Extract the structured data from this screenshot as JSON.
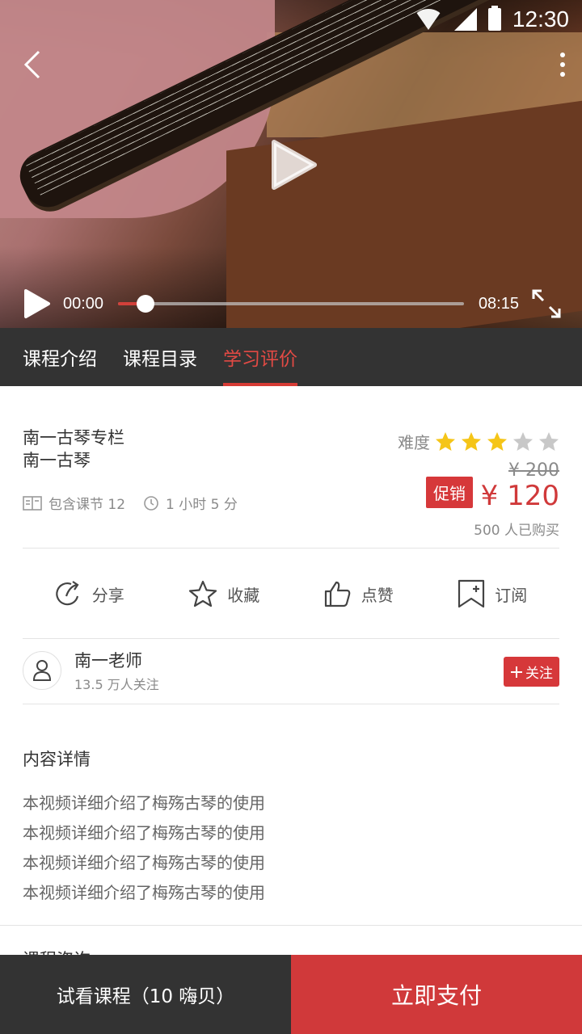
{
  "status_bar": {
    "time": "12:30"
  },
  "video": {
    "current_time": "00:00",
    "duration": "08:15",
    "progress": 0.08
  },
  "tabs": [
    {
      "label": "课程介绍",
      "active": false
    },
    {
      "label": "课程目录",
      "active": false
    },
    {
      "label": "学习评价",
      "active": true
    }
  ],
  "course": {
    "title_line1": "南一古琴专栏",
    "title_line2": "南一古琴",
    "lessons": "包含课节 12",
    "duration": "1 小时 5 分",
    "difficulty_label": "难度",
    "difficulty_rating": 3,
    "difficulty_max": 5,
    "price_original": "¥ 200",
    "promo_label": "促销",
    "price_current": "¥ 120",
    "purchased": "500 人已购买"
  },
  "actions": [
    {
      "icon": "share-icon",
      "label": "分享"
    },
    {
      "icon": "star-icon",
      "label": "收藏"
    },
    {
      "icon": "thumbs-up-icon",
      "label": "点赞"
    },
    {
      "icon": "bookmark-icon",
      "label": "订阅"
    }
  ],
  "teacher": {
    "name": "南一老师",
    "followers": "13.5 万人关注",
    "follow_label": "关注"
  },
  "content": {
    "title": "内容详情",
    "lines": [
      "本视频详细介绍了梅殇古琴的使用",
      "本视频详细介绍了梅殇古琴的使用",
      "本视频详细介绍了梅殇古琴的使用",
      "本视频详细介绍了梅殇古琴的使用"
    ],
    "next_section_title": "课程咨询"
  },
  "bottom_bar": {
    "trial_label": "试看课程（10 嗨贝）",
    "pay_label": "立即支付"
  },
  "colors": {
    "accent": "#d0393a",
    "dark": "#333333",
    "star_active": "#f5c518",
    "star_inactive": "#c8c8c8"
  }
}
